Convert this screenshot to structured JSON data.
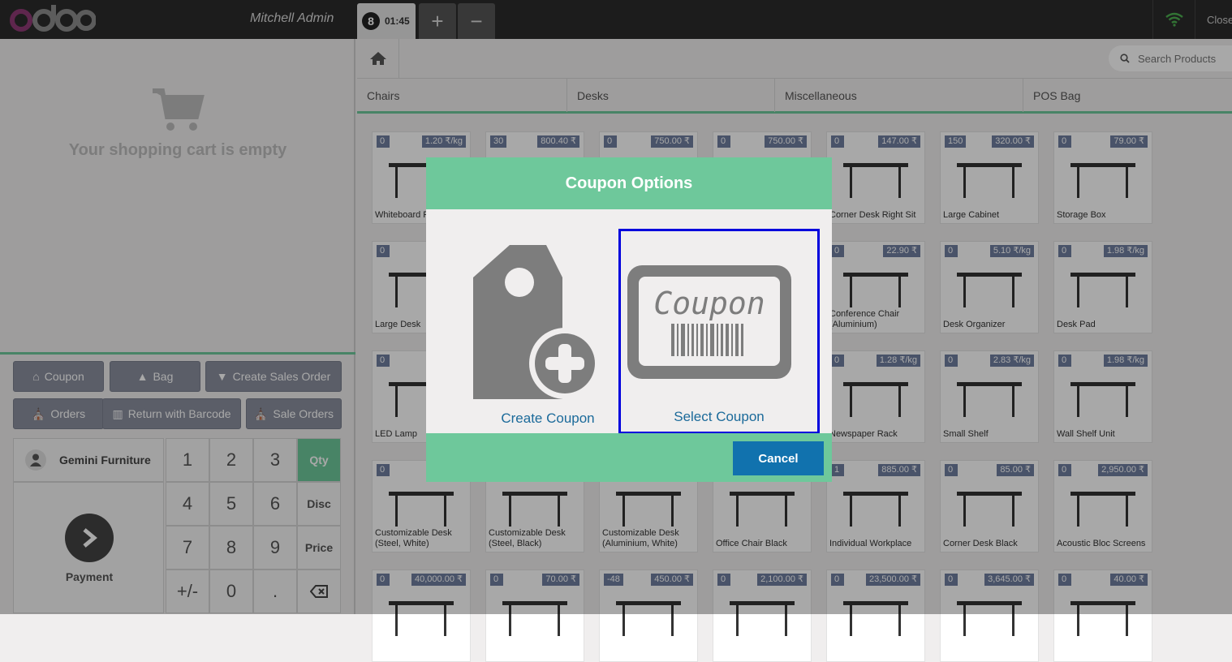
{
  "topbar": {
    "cashier": "Mitchell Admin",
    "order": {
      "number": "8",
      "time": "01:45"
    },
    "add_order": "+",
    "remove_order": "−",
    "close": "Close"
  },
  "cart": {
    "empty_text": "Your shopping cart is empty"
  },
  "controls": [
    {
      "label": "Coupon",
      "icon": "gift-icon"
    },
    {
      "label": "Bag",
      "icon": "shopping-bag-icon"
    },
    {
      "label": "Create Sales Order",
      "icon": "cart-icon"
    },
    {
      "label": "Orders",
      "icon": "bank-icon"
    },
    {
      "label": "Return with Barcode",
      "icon": "barcode-icon"
    },
    {
      "label": "Sale Orders",
      "icon": "bank-icon"
    }
  ],
  "customer": {
    "name": "Gemini Furniture"
  },
  "payment": {
    "label": "Payment"
  },
  "numpad": {
    "keys": [
      "1",
      "2",
      "3",
      "4",
      "5",
      "6",
      "7",
      "8",
      "9",
      "+/-",
      "0",
      "."
    ],
    "modes": [
      "Qty",
      "Disc",
      "Price"
    ],
    "active_mode": "Qty"
  },
  "search": {
    "placeholder": "Search Products"
  },
  "categories": [
    "Chairs",
    "Desks",
    "Miscellaneous",
    "POS Bag"
  ],
  "products": [
    {
      "qty": "0",
      "price": "1.20 ₹/kg",
      "name": "Whiteboard Pen"
    },
    {
      "qty": "30",
      "price": "800.40 ₹",
      "name": ""
    },
    {
      "qty": "0",
      "price": "750.00 ₹",
      "name": ""
    },
    {
      "qty": "0",
      "price": "750.00 ₹",
      "name": ""
    },
    {
      "qty": "0",
      "price": "147.00 ₹",
      "name": "Corner Desk Right Sit"
    },
    {
      "qty": "150",
      "price": "320.00 ₹",
      "name": "Large Cabinet"
    },
    {
      "qty": "0",
      "price": "79.00 ₹",
      "name": "Storage Box"
    },
    {
      "qty": "0",
      "price": "",
      "name": "Large Desk"
    },
    {
      "qty": "",
      "price": "",
      "name": ""
    },
    {
      "qty": "",
      "price": "",
      "name": ""
    },
    {
      "qty": "",
      "price": "",
      "name": ""
    },
    {
      "qty": "0",
      "price": "22.90 ₹",
      "name": "Conference Chair (Aluminium)"
    },
    {
      "qty": "0",
      "price": "5.10 ₹/kg",
      "name": "Desk Organizer"
    },
    {
      "qty": "0",
      "price": "1.98 ₹/kg",
      "name": "Desk Pad"
    },
    {
      "qty": "0",
      "price": "",
      "name": "LED Lamp"
    },
    {
      "qty": "",
      "price": "",
      "name": ""
    },
    {
      "qty": "",
      "price": "",
      "name": ""
    },
    {
      "qty": "",
      "price": "",
      "name": ""
    },
    {
      "qty": "0",
      "price": "1.28 ₹/kg",
      "name": "Newspaper Rack"
    },
    {
      "qty": "0",
      "price": "2.83 ₹/kg",
      "name": "Small Shelf"
    },
    {
      "qty": "0",
      "price": "1.98 ₹/kg",
      "name": "Wall Shelf Unit"
    },
    {
      "qty": "0",
      "price": "",
      "name": "Customizable Desk (Steel, White)"
    },
    {
      "qty": "",
      "price": "",
      "name": "Customizable Desk (Steel, Black)"
    },
    {
      "qty": "",
      "price": "",
      "name": "Customizable Desk (Aluminium, White)"
    },
    {
      "qty": "",
      "price": "",
      "name": "Office Chair Black"
    },
    {
      "qty": "1",
      "price": "885.00 ₹",
      "name": "Individual Workplace"
    },
    {
      "qty": "0",
      "price": "85.00 ₹",
      "name": "Corner Desk Black"
    },
    {
      "qty": "0",
      "price": "2,950.00 ₹",
      "name": "Acoustic Bloc Screens"
    },
    {
      "qty": "0",
      "price": "40,000.00 ₹",
      "name": ""
    },
    {
      "qty": "0",
      "price": "70.00 ₹",
      "name": ""
    },
    {
      "qty": "-48",
      "price": "450.00 ₹",
      "name": ""
    },
    {
      "qty": "0",
      "price": "2,100.00 ₹",
      "name": ""
    },
    {
      "qty": "0",
      "price": "23,500.00 ₹",
      "name": ""
    },
    {
      "qty": "0",
      "price": "3,645.00 ₹",
      "name": ""
    },
    {
      "qty": "0",
      "price": "40.00 ₹",
      "name": ""
    }
  ],
  "modal": {
    "title": "Coupon Options",
    "create_label": "Create Coupon",
    "select_label": "Select Coupon",
    "coupon_graphic_text": "Coupon",
    "cancel": "Cancel"
  },
  "colors": {
    "accent": "#6ec89b",
    "primary_button": "#1172ae",
    "badge": "#6f7fa0",
    "selection": "#0000dd"
  }
}
